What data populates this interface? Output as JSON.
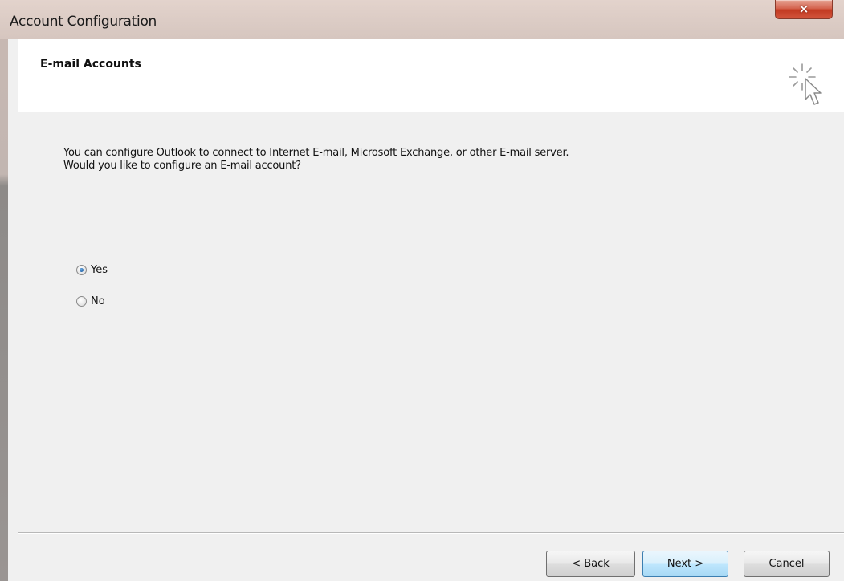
{
  "window": {
    "title": "Account Configuration",
    "close_glyph": "×"
  },
  "header": {
    "title": "E-mail Accounts",
    "icon": "cursor-sparkle-icon"
  },
  "main": {
    "description": "You can configure Outlook to connect to Internet E-mail, Microsoft Exchange, or other E-mail server. Would you like to configure an E-mail account?",
    "options": [
      {
        "label": "Yes",
        "selected": true
      },
      {
        "label": "No",
        "selected": false
      }
    ]
  },
  "footer": {
    "back_label": "< Back",
    "next_label": "Next >",
    "cancel_label": "Cancel"
  },
  "colors": {
    "titlebar": "#d9c9c2",
    "close_button": "#c9412a",
    "dialog_background": "#f0f0f0",
    "header_background": "#ffffff",
    "default_button_border": "#3c7fb1"
  }
}
